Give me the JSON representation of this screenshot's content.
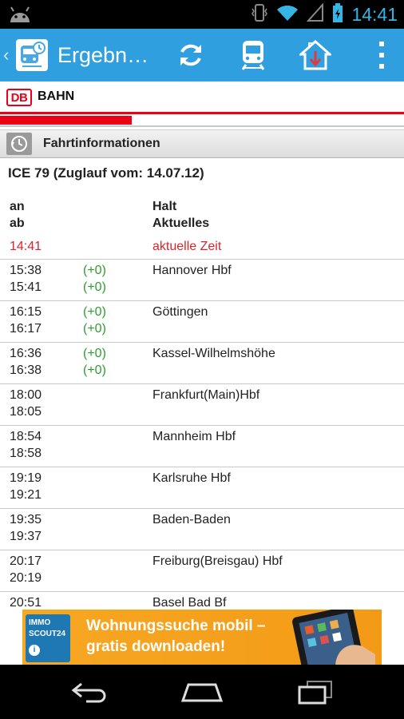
{
  "status_bar": {
    "time": "14:41"
  },
  "action_bar": {
    "title": "Ergebn…",
    "actions": [
      "refresh-icon",
      "train-icon",
      "home-icon",
      "overflow-menu-icon"
    ]
  },
  "db_header": {
    "logo": "DB",
    "brand": "BAHN"
  },
  "section": {
    "title": "Fahrtinformationen"
  },
  "train": {
    "info": "ICE 79 (Zuglauf vom: 14.07.12)"
  },
  "columns": {
    "left_1": "an",
    "left_2": "ab",
    "right_1": "Halt",
    "right_2": "Aktuelles"
  },
  "current": {
    "time": "14:41",
    "label": "aktuelle Zeit"
  },
  "stops": [
    {
      "arr": "15:38",
      "dep": "15:41",
      "delay_arr": "(+0)",
      "delay_dep": "(+0)",
      "name": "Hannover Hbf"
    },
    {
      "arr": "16:15",
      "dep": "16:17",
      "delay_arr": "(+0)",
      "delay_dep": "(+0)",
      "name": "Göttingen"
    },
    {
      "arr": "16:36",
      "dep": "16:38",
      "delay_arr": "(+0)",
      "delay_dep": "(+0)",
      "name": "Kassel-Wilhelmshöhe"
    },
    {
      "arr": "18:00",
      "dep": "18:05",
      "delay_arr": "",
      "delay_dep": "",
      "name": "Frankfurt(Main)Hbf"
    },
    {
      "arr": "18:54",
      "dep": "18:58",
      "delay_arr": "",
      "delay_dep": "",
      "name": "Mannheim Hbf"
    },
    {
      "arr": "19:19",
      "dep": "19:21",
      "delay_arr": "",
      "delay_dep": "",
      "name": "Karlsruhe Hbf"
    },
    {
      "arr": "19:35",
      "dep": "19:37",
      "delay_arr": "",
      "delay_dep": "",
      "name": "Baden-Baden"
    },
    {
      "arr": "20:17",
      "dep": "20:19",
      "delay_arr": "",
      "delay_dep": "",
      "name": "Freiburg(Breisgau) Hbf"
    },
    {
      "arr": "20:51",
      "dep": "",
      "delay_arr": "",
      "delay_dep": "",
      "name": "Basel Bad Bf"
    }
  ],
  "ad": {
    "logo_line1": "IMMO",
    "logo_line2": "SCOUT24",
    "line1": "Wohnungssuche mobil –",
    "line2": "gratis downloaden!"
  },
  "colors": {
    "accent": "#2f9fe0",
    "db_red": "#ec0016",
    "delay_green": "#2e9e2e",
    "current_red": "#d8252e"
  }
}
